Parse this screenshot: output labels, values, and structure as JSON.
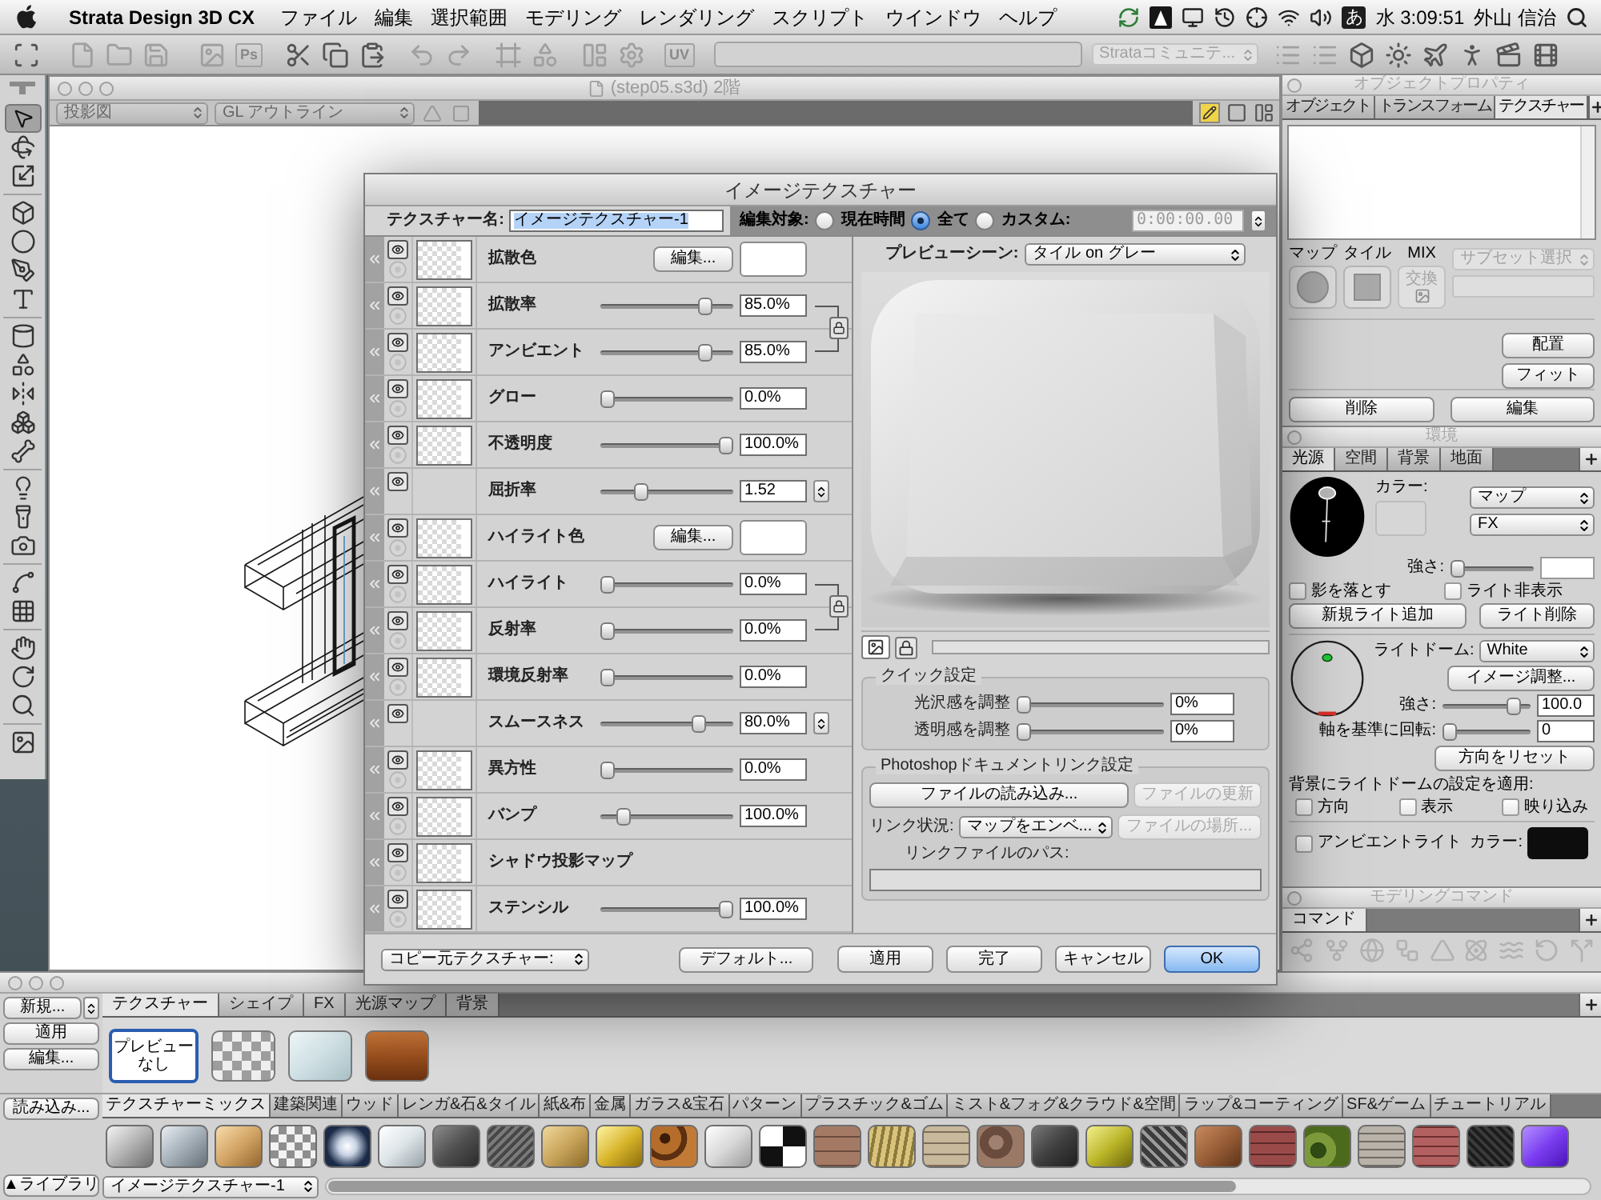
{
  "menu_bar": {
    "app": "Strata Design 3D CX",
    "menus": [
      "ファイル",
      "編集",
      "選択範囲",
      "モデリング",
      "レンダリング",
      "スクリプト",
      "ウインドウ",
      "ヘルプ"
    ],
    "input_mode": "あ",
    "clock": "水 3:09:51",
    "user": "外山 信治"
  },
  "toolbar": {
    "ps_button": "Ps",
    "uv_button": "UV",
    "community_menu": {
      "label": "Strataコミュニテ...",
      "disabled": true
    }
  },
  "tool_palette": {
    "tools": [
      {
        "selected": true
      },
      {
        "selected": false
      },
      {
        "selected": false
      },
      {
        "selected": false
      },
      {
        "selected": false
      },
      {
        "selected": false
      },
      {
        "selected": false
      },
      {
        "selected": false
      },
      {
        "selected": false
      },
      {
        "selected": false
      },
      {
        "selected": false
      },
      {
        "selected": false
      },
      {
        "selected": false
      },
      {
        "selected": false
      },
      {
        "selected": false
      },
      {
        "selected": false
      },
      {
        "selected": false
      },
      {
        "selected": false
      },
      {
        "selected": false
      },
      {
        "selected": false
      },
      {
        "selected": false
      }
    ]
  },
  "viewport": {
    "title": "(step05.s3d) 2階",
    "active": false,
    "projection_menu": "投影図",
    "render_menu": "GL アウトライン"
  },
  "object_properties": {
    "title": "オブジェクトプロパティ",
    "active": false,
    "tabs": [
      {
        "label": "オブジェクト",
        "selected": false
      },
      {
        "label": "トランスフォーム",
        "selected": false
      },
      {
        "label": "テクスチャー",
        "selected": true
      }
    ],
    "map_labels": [
      "マップ",
      "タイル",
      "MIX"
    ],
    "swap_button": {
      "label": "交換",
      "disabled": true
    },
    "subset_menu": {
      "label": "サブセット選択",
      "disabled": true
    },
    "side_buttons": [
      "配置",
      "フィット"
    ],
    "bottom_buttons": [
      "削除",
      "編集"
    ]
  },
  "environment": {
    "title": "環境",
    "active": false,
    "tabs": [
      {
        "label": "光源",
        "selected": true
      },
      {
        "label": "空間",
        "selected": false
      },
      {
        "label": "背景",
        "selected": false
      },
      {
        "label": "地面",
        "selected": false
      }
    ],
    "color_label": "カラー:",
    "map_menu": "マップ",
    "fx_menu": "FX",
    "light_intensity": {
      "label": "強さ:",
      "level": 0
    },
    "light_options": [
      {
        "label": "影を落とす",
        "checked": false
      },
      {
        "label": "ライト非表示",
        "checked": false
      }
    ],
    "light_buttons": [
      "新規ライト追加",
      "ライト削除"
    ],
    "dome_label": "ライトドーム:",
    "dome_menu": "White",
    "image_adjust_button": "イメージ調整...",
    "dome_intensity": {
      "label": "強さ:",
      "level": 0.88,
      "value": "100.0"
    },
    "rotation": {
      "label": "軸を基準に回転:",
      "level": 0,
      "value": "0"
    },
    "reset_button": "方向をリセット",
    "apply_label": "背景にライトドームの設定を適用:",
    "apply_options": [
      {
        "label": "方向",
        "checked": false
      },
      {
        "label": "表示",
        "checked": false
      },
      {
        "label": "映り込み",
        "checked": false
      }
    ],
    "ambient": {
      "label": "アンビエントライト",
      "checked": false,
      "color_label": "カラー:",
      "color": "#0d0d0d"
    }
  },
  "modeling_commands": {
    "title": "モデリングコマンド",
    "active": false,
    "tabs": [
      {
        "label": "コマンド",
        "selected": true
      }
    ]
  },
  "texture_palette": {
    "side_buttons": [
      "新規...",
      "適用",
      "編集..."
    ],
    "tabs": [
      {
        "label": "テクスチャー",
        "selected": true
      },
      {
        "label": "シェイプ",
        "selected": false
      },
      {
        "label": "FX",
        "selected": false
      },
      {
        "label": "光源マップ",
        "selected": false
      },
      {
        "label": "背景",
        "selected": false
      }
    ],
    "textures": [
      {
        "kind": "none",
        "label": "プレビューなし",
        "selected": true
      },
      {
        "kind": "checker",
        "selected": false
      },
      {
        "kind": "frost",
        "selected": false
      },
      {
        "kind": "wood",
        "selected": false
      }
    ],
    "load_button": "読み込み...",
    "library_tabs": [
      {
        "label": "テクスチャーミックス",
        "selected": true
      },
      {
        "label": "建築関連",
        "selected": false
      },
      {
        "label": "ウッド",
        "selected": false
      },
      {
        "label": "レンガ&石&タイル",
        "selected": false
      },
      {
        "label": "紙&布",
        "selected": false
      },
      {
        "label": "金属",
        "selected": false
      },
      {
        "label": "ガラス&宝石",
        "selected": false
      },
      {
        "label": "パターン",
        "selected": false
      },
      {
        "label": "プラスチック&ゴム",
        "selected": false
      },
      {
        "label": "ミスト&フォグ&クラウド&空間",
        "selected": false
      },
      {
        "label": "ラップ&コーティング",
        "selected": false
      },
      {
        "label": "SF&ゲーム",
        "selected": false
      },
      {
        "label": "チュートリアル",
        "selected": false
      }
    ],
    "library_button": "▲ライブラリ",
    "library_menu": "イメージテクスチャー-1"
  },
  "texture_dialog": {
    "title": "イメージテクスチャー",
    "name_label": "テクスチャー名:",
    "name_value": "イメージテクスチャー-1",
    "edit_target_label": "編集対象:",
    "edit_targets": [
      {
        "label": "現在時間",
        "selected": false
      },
      {
        "label": "全て",
        "selected": true
      },
      {
        "label": "カスタム:",
        "selected": false
      }
    ],
    "time_value": "0:00:00.00",
    "time_disabled": true,
    "channels": [
      {
        "kind": "color",
        "label": "拡散色",
        "has_map": true,
        "linked": false,
        "button": "編集...",
        "color": "#ffffff"
      },
      {
        "kind": "slider",
        "label": "拡散率",
        "has_map": true,
        "linked": true,
        "level": 0.82,
        "value": "85.0%"
      },
      {
        "kind": "slider",
        "label": "アンビエント",
        "has_map": true,
        "linked": true,
        "level": 0.82,
        "value": "85.0%"
      },
      {
        "kind": "slider",
        "label": "グロー",
        "has_map": true,
        "linked": false,
        "level": 0,
        "value": "0.0%"
      },
      {
        "kind": "slider",
        "label": "不透明度",
        "has_map": true,
        "linked": false,
        "level": 1,
        "value": "100.0%"
      },
      {
        "kind": "stepper",
        "label": "屈折率",
        "has_map": false,
        "linked": false,
        "level": 0.28,
        "value": "1.52"
      },
      {
        "kind": "color",
        "label": "ハイライト色",
        "has_map": true,
        "linked": false,
        "button": "編集...",
        "color": "#ffffff"
      },
      {
        "kind": "slider",
        "label": "ハイライト",
        "has_map": true,
        "linked": true,
        "level": 0,
        "value": "0.0%"
      },
      {
        "kind": "slider",
        "label": "反射率",
        "has_map": true,
        "linked": true,
        "level": 0,
        "value": "0.0%"
      },
      {
        "kind": "slider",
        "label": "環境反射率",
        "has_map": true,
        "linked": false,
        "level": 0,
        "value": "0.0%"
      },
      {
        "kind": "stepper",
        "label": "スムースネス",
        "has_map": false,
        "linked": false,
        "level": 0.77,
        "value": "80.0%"
      },
      {
        "kind": "slider",
        "label": "異方性",
        "has_map": true,
        "linked": false,
        "level": 0,
        "value": "0.0%"
      },
      {
        "kind": "slider",
        "label": "バンプ",
        "has_map": true,
        "linked": false,
        "level": 0.13,
        "value": "100.0%"
      },
      {
        "kind": "label",
        "label": "シャドウ投影マップ",
        "has_map": true,
        "linked": false
      },
      {
        "kind": "slider",
        "label": "ステンシル",
        "has_map": true,
        "linked": false,
        "level": 1,
        "value": "100.0%"
      }
    ],
    "preview_label": "プレビューシーン:",
    "preview_scene": "タイル on グレー",
    "quick_settings": {
      "title": "クイック設定",
      "sliders": [
        {
          "label": "光沢感を調整",
          "level": 0,
          "value": "0%"
        },
        {
          "label": "透明感を調整",
          "level": 0,
          "value": "0%"
        }
      ]
    },
    "photoshop_link": {
      "title": "Photoshopドキュメントリンク設定",
      "load_button": "ファイルの読み込み...",
      "update_button": {
        "label": "ファイルの更新",
        "disabled": true
      },
      "status_label": "リンク状況:",
      "status_value": "マップをエンベ...",
      "locate_button": {
        "label": "ファイルの場所...",
        "disabled": true
      },
      "path_label": "リンクファイルのパス:"
    },
    "copy_source_menu": "コピー元テクスチャー:",
    "default_button": "デフォルト...",
    "buttons": [
      {
        "label": "適用",
        "default": false
      },
      {
        "label": "完了",
        "default": false
      },
      {
        "label": "キャンセル",
        "default": false
      },
      {
        "label": "OK",
        "default": true
      }
    ]
  }
}
